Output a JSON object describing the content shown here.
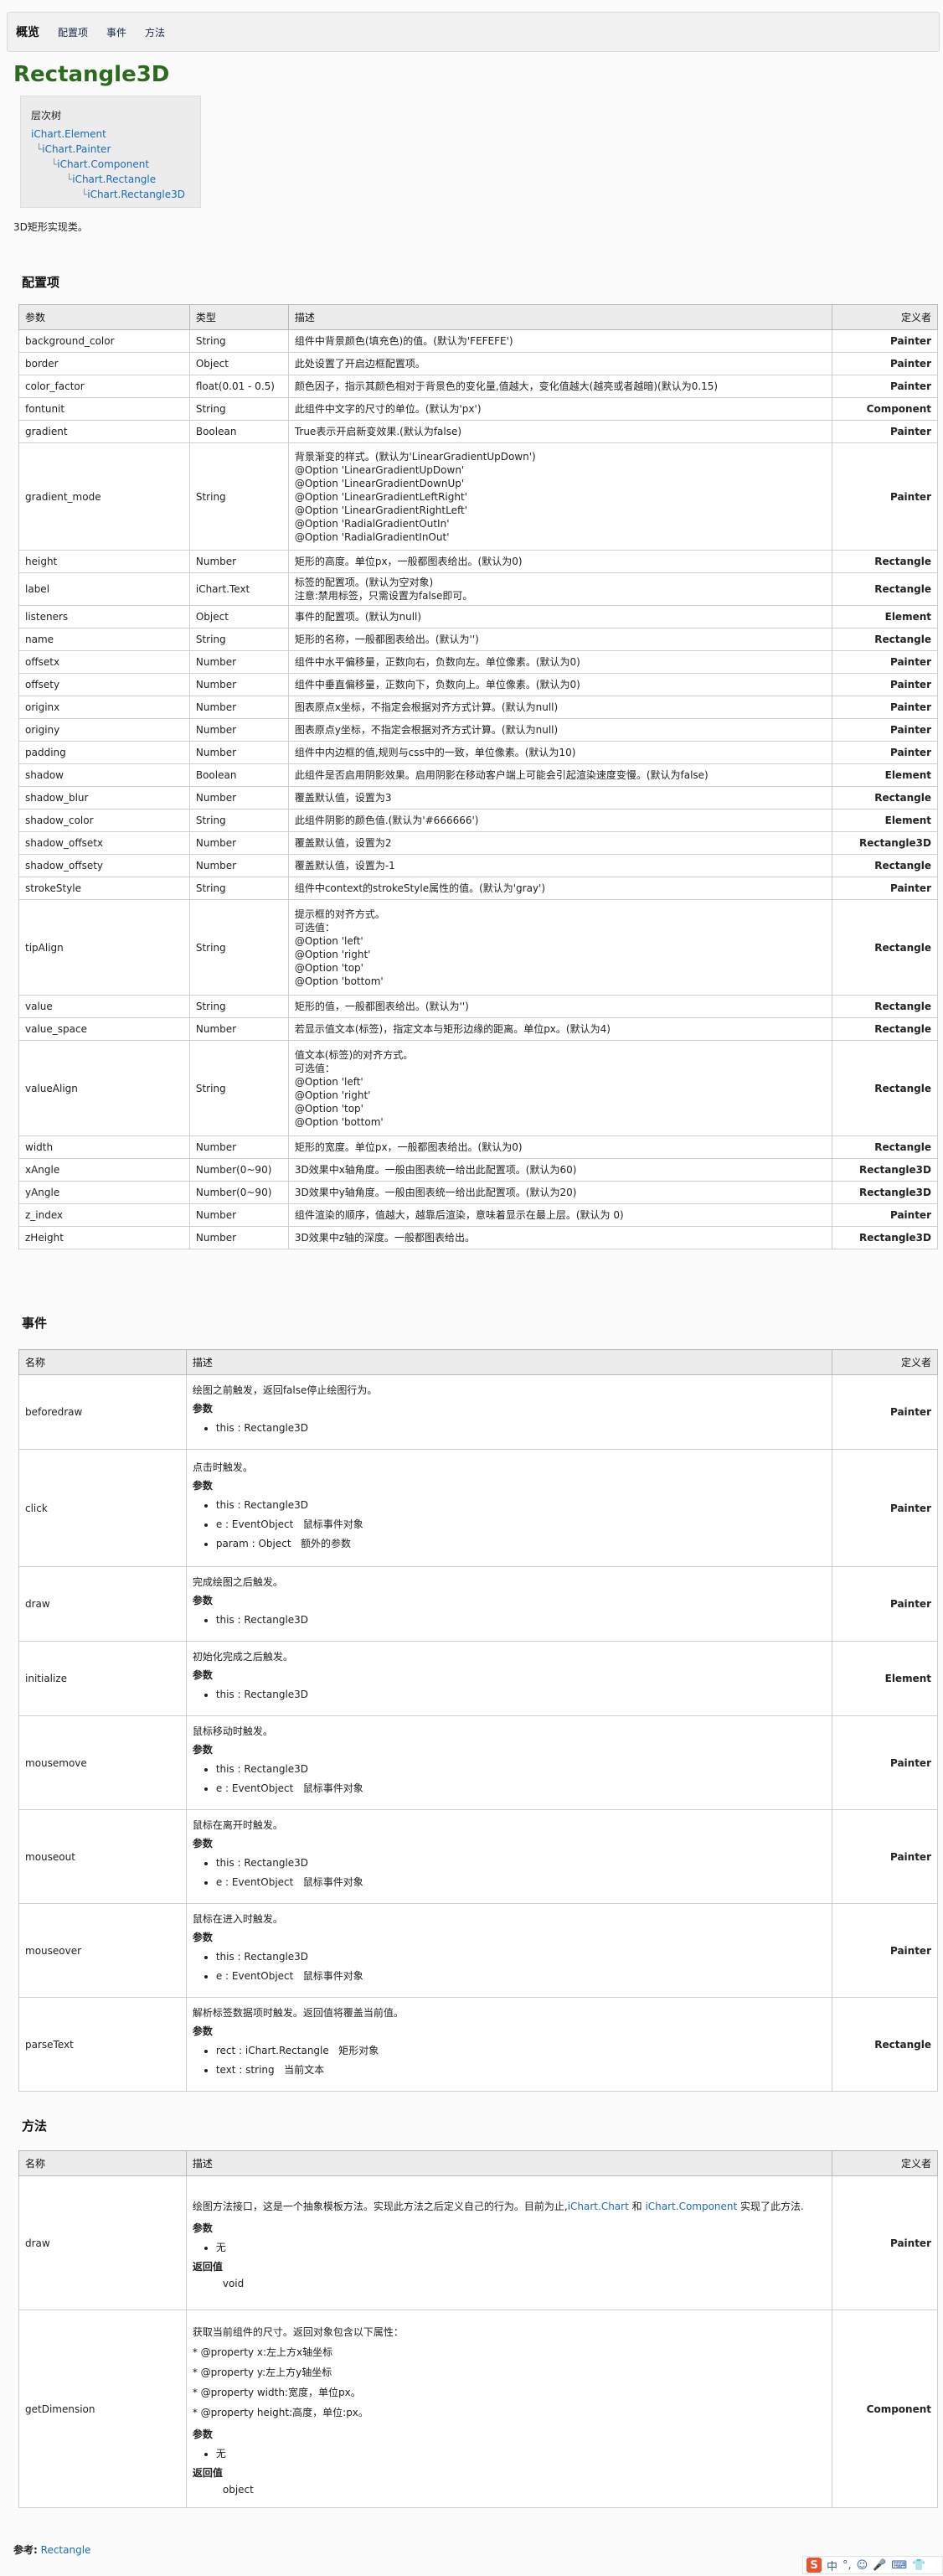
{
  "nav": {
    "items": [
      "概览",
      "配置项",
      "事件",
      "方法"
    ]
  },
  "title": "Rectangle3D",
  "hierarchy": {
    "title": "层次树",
    "items": [
      "iChart.Element",
      "iChart.Painter",
      "iChart.Component",
      "iChart.Rectangle",
      "iChart.Rectangle3D"
    ]
  },
  "description": "3D矩形实现类。",
  "config": {
    "heading": "配置项",
    "headers": [
      "参数",
      "类型",
      "描述",
      "定义者"
    ],
    "rows": [
      {
        "name": "background_color",
        "type": "String",
        "desc": "组件中背景颜色(填充色)的值。(默认为'FEFEFE')",
        "def": "Painter"
      },
      {
        "name": "border",
        "type": "Object",
        "desc": "此处设置了开启边框配置项。",
        "def": "Painter"
      },
      {
        "name": "color_factor",
        "type": "float(0.01 - 0.5)",
        "desc": "颜色因子，指示其颜色相对于背景色的变化量,值越大，变化值越大(越亮或者越暗)(默认为0.15)",
        "def": "Painter"
      },
      {
        "name": "fontunit",
        "type": "String",
        "desc": "此组件中文字的尺寸的单位。(默认为'px')",
        "def": "Component"
      },
      {
        "name": "gradient",
        "type": "Boolean",
        "desc": "True表示开启新变效果.(默认为false)",
        "def": "Painter"
      },
      {
        "name": "gradient_mode",
        "type": "String",
        "desc": "背景渐变的样式。(默认为'LinearGradientUpDown')\n@Option 'LinearGradientUpDown'\n@Option 'LinearGradientDownUp'\n@Option 'LinearGradientLeftRight'\n@Option 'LinearGradientRightLeft'\n@Option 'RadialGradientOutIn'\n@Option 'RadialGradientInOut'",
        "def": "Painter"
      },
      {
        "name": "height",
        "type": "Number",
        "desc": "矩形的高度。单位px，一般都图表给出。(默认为0)",
        "def": "Rectangle"
      },
      {
        "name": "label",
        "type": "iChart.Text",
        "type_link": true,
        "desc": "标签的配置项。(默认为空对象)\n注意:禁用标签，只需设置为false即可。",
        "def": "Rectangle"
      },
      {
        "name": "listeners",
        "type": "Object",
        "desc": "事件的配置项。(默认为null)",
        "def": "Element"
      },
      {
        "name": "name",
        "type": "String",
        "desc": "矩形的名称，一般都图表给出。(默认为'')",
        "def": "Rectangle"
      },
      {
        "name": "offsetx",
        "type": "Number",
        "desc": "组件中水平偏移量，正数向右，负数向左。单位像素。(默认为0)",
        "def": "Painter"
      },
      {
        "name": "offsety",
        "type": "Number",
        "desc": "组件中垂直偏移量，正数向下，负数向上。单位像素。(默认为0)",
        "def": "Painter"
      },
      {
        "name": "originx",
        "type": "Number",
        "desc": "图表原点x坐标，不指定会根据对齐方式计算。(默认为null)",
        "def": "Painter"
      },
      {
        "name": "originy",
        "type": "Number",
        "desc": "图表原点y坐标，不指定会根据对齐方式计算。(默认为null)",
        "def": "Painter"
      },
      {
        "name": "padding",
        "type": "Number",
        "desc": "组件中内边框的值,规则与css中的一致，单位像素。(默认为10)",
        "def": "Painter"
      },
      {
        "name": "shadow",
        "type": "Boolean",
        "desc": "此组件是否启用阴影效果。启用阴影在移动客户端上可能会引起渲染速度变慢。(默认为false)",
        "def": "Element"
      },
      {
        "name": "shadow_blur",
        "type": "Number",
        "desc": "覆盖默认值，设置为3",
        "def": "Rectangle"
      },
      {
        "name": "shadow_color",
        "type": "String",
        "desc": "此组件阴影的颜色值.(默认为'#666666')",
        "def": "Element"
      },
      {
        "name": "shadow_offsetx",
        "type": "Number",
        "desc": "覆盖默认值，设置为2",
        "def": "Rectangle3D"
      },
      {
        "name": "shadow_offsety",
        "type": "Number",
        "desc": "覆盖默认值，设置为-1",
        "def": "Rectangle"
      },
      {
        "name": "strokeStyle",
        "type": "String",
        "desc": "组件中context的strokeStyle属性的值。(默认为'gray')",
        "def": "Painter"
      },
      {
        "name": "tipAlign",
        "type": "String",
        "desc": "提示框的对齐方式。\n可选值：\n@Option 'left'\n@Option 'right'\n@Option 'top'\n@Option 'bottom'",
        "def": "Rectangle"
      },
      {
        "name": "value",
        "type": "String",
        "desc": "矩形的值，一般都图表给出。(默认为'')",
        "def": "Rectangle"
      },
      {
        "name": "value_space",
        "type": "Number",
        "desc": "若显示值文本(标签)，指定文本与矩形边缘的距离。单位px。(默认为4)",
        "def": "Rectangle"
      },
      {
        "name": "valueAlign",
        "type": "String",
        "desc": "值文本(标签)的对齐方式。\n可选值：\n@Option 'left'\n@Option 'right'\n@Option 'top'\n@Option 'bottom'",
        "def": "Rectangle"
      },
      {
        "name": "width",
        "type": "Number",
        "desc": "矩形的宽度。单位px，一般都图表给出。(默认为0)",
        "def": "Rectangle"
      },
      {
        "name": "xAngle",
        "type": "Number(0~90)",
        "desc": "3D效果中x轴角度。一般由图表统一给出此配置项。(默认为60)",
        "def": "Rectangle3D"
      },
      {
        "name": "yAngle",
        "type": "Number(0~90)",
        "desc": "3D效果中y轴角度。一般由图表统一给出此配置项。(默认为20)",
        "def": "Rectangle3D"
      },
      {
        "name": "z_index",
        "type": "Number",
        "desc": "组件渲染的顺序，值越大，越靠后渲染，意味着显示在最上层。(默认为 0)",
        "def": "Painter"
      },
      {
        "name": "zHeight",
        "type": "Number",
        "desc": "3D效果中z轴的深度。一般都图表给出。",
        "def": "Rectangle3D"
      }
    ]
  },
  "events": {
    "heading": "事件",
    "headers": [
      "名称",
      "描述",
      "定义者"
    ],
    "params_label": "参数",
    "rows": [
      {
        "name": "beforedraw",
        "desc": "绘图之前触发，返回false停止绘图行为。",
        "params": [
          "this : Rectangle3D"
        ],
        "def": "Painter"
      },
      {
        "name": "click",
        "desc": "点击时触发。",
        "params": [
          "this : Rectangle3D",
          "e : EventObject   鼠标事件对象",
          "param : Object   额外的参数"
        ],
        "def": "Painter"
      },
      {
        "name": "draw",
        "desc": "完成绘图之后触发。",
        "params": [
          "this : Rectangle3D"
        ],
        "def": "Painter"
      },
      {
        "name": "initialize",
        "desc": "初始化完成之后触发。",
        "params": [
          "this : Rectangle3D"
        ],
        "def": "Element"
      },
      {
        "name": "mousemove",
        "desc": "鼠标移动时触发。",
        "params": [
          "this : Rectangle3D",
          "e : EventObject   鼠标事件对象"
        ],
        "def": "Painter"
      },
      {
        "name": "mouseout",
        "desc": "鼠标在离开时触发。",
        "params": [
          "this : Rectangle3D",
          "e : EventObject   鼠标事件对象"
        ],
        "def": "Painter"
      },
      {
        "name": "mouseover",
        "desc": "鼠标在进入时触发。",
        "params": [
          "this : Rectangle3D",
          "e : EventObject   鼠标事件对象"
        ],
        "def": "Painter"
      },
      {
        "name": "parseText",
        "desc": "解析标签数据项时触发。返回值将覆盖当前值。",
        "params": [
          "rect : iChart.Rectangle   矩形对象",
          "text : string   当前文本"
        ],
        "def": "Rectangle"
      }
    ]
  },
  "methods": {
    "heading": "方法",
    "headers": [
      "名称",
      "描述",
      "定义者"
    ],
    "params_label": "参数",
    "returns_label": "返回值",
    "rows": [
      {
        "name": "draw",
        "desc_pre": "绘图方法接口，这是一个抽象模板方法。实现此方法之后定义自己的行为。目前为止,",
        "desc_link1": "iChart.Chart",
        "desc_mid": " 和 ",
        "desc_link2": "iChart.Component",
        "desc_post": " 实现了此方法.",
        "params": [
          "无"
        ],
        "returns": "void",
        "def": "Painter"
      },
      {
        "name": "getDimension",
        "desc_lines": [
          "获取当前组件的尺寸。返回对象包含以下属性：",
          "* @property x:左上方x轴坐标",
          "* @property y:左上方y轴坐标",
          "* @property width:宽度，单位px。",
          "* @property height:高度，单位:px。"
        ],
        "params": [
          "无"
        ],
        "returns": "object",
        "def": "Component"
      }
    ]
  },
  "see_also": {
    "label": "参考:",
    "link": "Rectangle"
  },
  "ime": {
    "logo": "S",
    "text": "中"
  }
}
